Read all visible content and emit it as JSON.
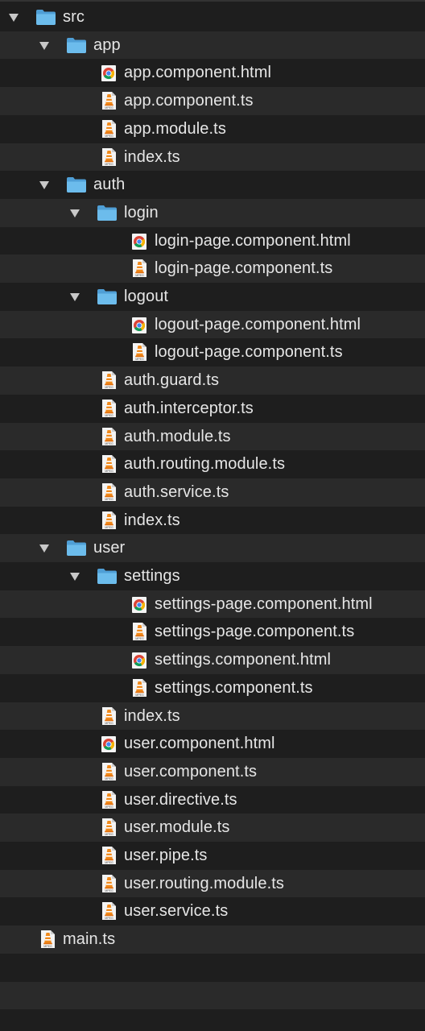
{
  "tree": {
    "items": [
      {
        "name": "src",
        "type": "folder",
        "expanded": true,
        "depth": 0
      },
      {
        "name": "app",
        "type": "folder",
        "expanded": true,
        "depth": 1
      },
      {
        "name": "app.component.html",
        "type": "html",
        "depth": 2
      },
      {
        "name": "app.component.ts",
        "type": "ts",
        "depth": 2
      },
      {
        "name": "app.module.ts",
        "type": "ts",
        "depth": 2
      },
      {
        "name": "index.ts",
        "type": "ts",
        "depth": 2
      },
      {
        "name": "auth",
        "type": "folder",
        "expanded": true,
        "depth": 1
      },
      {
        "name": "login",
        "type": "folder",
        "expanded": true,
        "depth": 2
      },
      {
        "name": "login-page.component.html",
        "type": "html",
        "depth": 3
      },
      {
        "name": "login-page.component.ts",
        "type": "ts",
        "depth": 3
      },
      {
        "name": "logout",
        "type": "folder",
        "expanded": true,
        "depth": 2
      },
      {
        "name": "logout-page.component.html",
        "type": "html",
        "depth": 3
      },
      {
        "name": "logout-page.component.ts",
        "type": "ts",
        "depth": 3
      },
      {
        "name": "auth.guard.ts",
        "type": "ts",
        "depth": 2
      },
      {
        "name": "auth.interceptor.ts",
        "type": "ts",
        "depth": 2
      },
      {
        "name": "auth.module.ts",
        "type": "ts",
        "depth": 2
      },
      {
        "name": "auth.routing.module.ts",
        "type": "ts",
        "depth": 2
      },
      {
        "name": "auth.service.ts",
        "type": "ts",
        "depth": 2
      },
      {
        "name": "index.ts",
        "type": "ts",
        "depth": 2
      },
      {
        "name": "user",
        "type": "folder",
        "expanded": true,
        "depth": 1
      },
      {
        "name": "settings",
        "type": "folder",
        "expanded": true,
        "depth": 2
      },
      {
        "name": "settings-page.component.html",
        "type": "html",
        "depth": 3
      },
      {
        "name": "settings-page.component.ts",
        "type": "ts",
        "depth": 3
      },
      {
        "name": "settings.component.html",
        "type": "html",
        "depth": 3
      },
      {
        "name": "settings.component.ts",
        "type": "ts",
        "depth": 3
      },
      {
        "name": "index.ts",
        "type": "ts",
        "depth": 2
      },
      {
        "name": "user.component.html",
        "type": "html",
        "depth": 2
      },
      {
        "name": "user.component.ts",
        "type": "ts",
        "depth": 2
      },
      {
        "name": "user.directive.ts",
        "type": "ts",
        "depth": 2
      },
      {
        "name": "user.module.ts",
        "type": "ts",
        "depth": 2
      },
      {
        "name": "user.pipe.ts",
        "type": "ts",
        "depth": 2
      },
      {
        "name": "user.routing.module.ts",
        "type": "ts",
        "depth": 2
      },
      {
        "name": "user.service.ts",
        "type": "ts",
        "depth": 2
      },
      {
        "name": "main.ts",
        "type": "ts",
        "depth": 0
      }
    ],
    "icons": {
      "folder": "folder-icon",
      "html": "chrome-html-file-icon",
      "ts": "vlc-mpeg-file-icon"
    },
    "ts_icon_caption": "MPEG",
    "colors": {
      "background": "#1e1e1e",
      "stripe": "#2a2a2a",
      "text": "#e6e6e6",
      "folder": "#5aaee0",
      "disclosure": "#c8c8c8"
    }
  }
}
